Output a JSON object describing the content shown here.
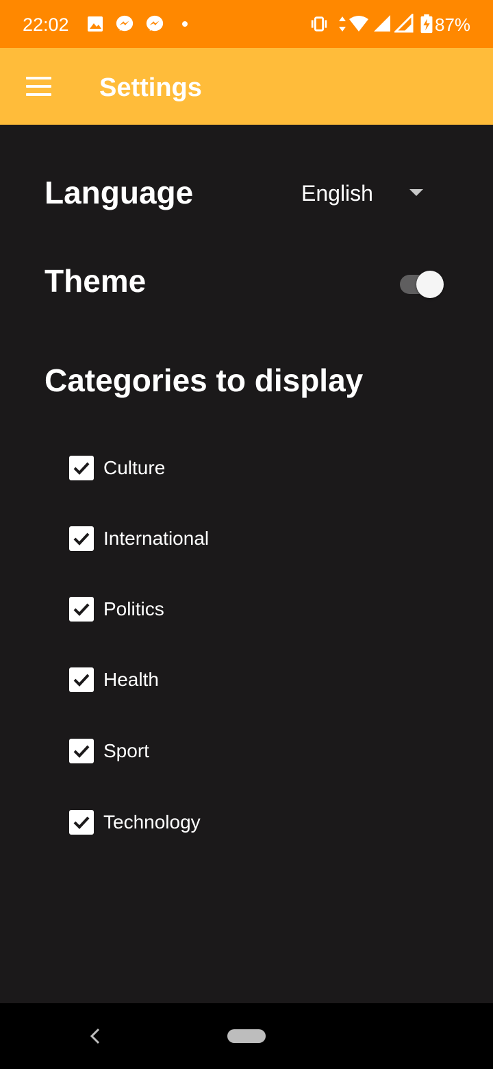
{
  "status_bar": {
    "time": "22:02",
    "battery": "87%",
    "icons": [
      "gallery-icon",
      "messenger-icon",
      "messenger-icon",
      "dot-icon",
      "vibrate-icon",
      "data-arrows-icon",
      "wifi-icon",
      "signal-icon",
      "signal-x-icon",
      "battery-charging-icon"
    ],
    "background": "#ff8800"
  },
  "app_bar": {
    "title": "Settings",
    "background": "#ffbc3a"
  },
  "settings": {
    "language": {
      "label": "Language",
      "value": "English"
    },
    "theme": {
      "label": "Theme",
      "toggle_on": true
    },
    "categories": {
      "title": "Categories to display",
      "items": [
        {
          "label": "Culture",
          "checked": true
        },
        {
          "label": "International",
          "checked": true
        },
        {
          "label": "Politics",
          "checked": true
        },
        {
          "label": "Health",
          "checked": true
        },
        {
          "label": "Sport",
          "checked": true
        },
        {
          "label": "Technology",
          "checked": true
        }
      ]
    }
  },
  "theme_colors": {
    "background": "#1b191a",
    "text": "#ffffff"
  }
}
